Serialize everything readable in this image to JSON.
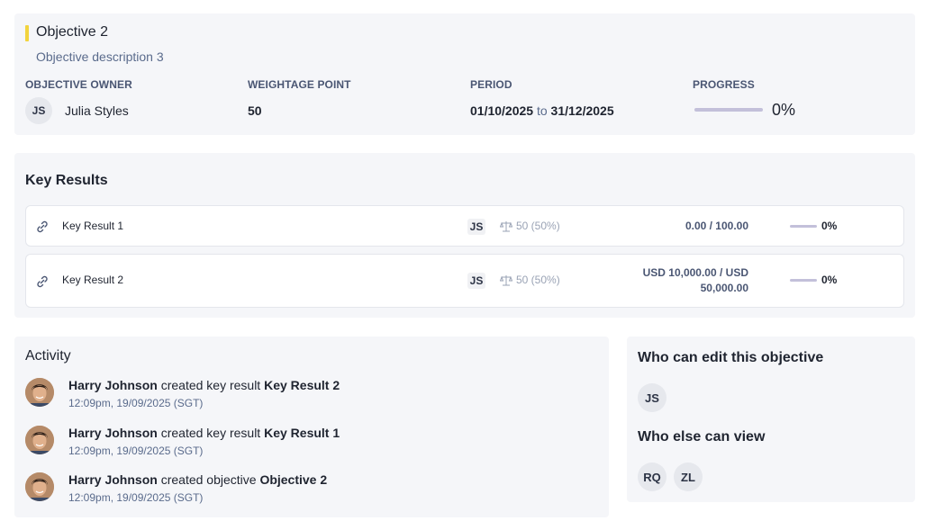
{
  "objective": {
    "title": "Objective 2",
    "description": "Objective description 3",
    "owner_label": "OBJECTIVE OWNER",
    "owner_initials": "JS",
    "owner_name": "Julia Styles",
    "weightage_label": "WEIGHTAGE POINT",
    "weightage_value": "50",
    "period_label": "PERIOD",
    "period_start": "01/10/2025",
    "period_to": "to",
    "period_end": "31/12/2025",
    "progress_label": "PROGRESS",
    "progress_value": "0%",
    "progress_fraction": 0,
    "accent_color": "#f2d43d"
  },
  "key_results": {
    "heading": "Key Results",
    "items": [
      {
        "icon": "link-icon",
        "name": "Key Result 1",
        "owner": "JS",
        "weight": "50 (50%)",
        "value": "0.00 / 100.00",
        "progress": "0%"
      },
      {
        "icon": "link-icon",
        "name": "Key Result 2",
        "owner": "JS",
        "weight": "50 (50%)",
        "value": "USD 10,000.00 / USD 50,000.00",
        "progress": "0%"
      }
    ]
  },
  "activity": {
    "heading": "Activity",
    "items": [
      {
        "user": "Harry Johnson",
        "action": "created key result",
        "target": "Key Result 2",
        "time": "12:09pm, 19/09/2025 (SGT)"
      },
      {
        "user": "Harry Johnson",
        "action": "created key result",
        "target": "Key Result 1",
        "time": "12:09pm, 19/09/2025 (SGT)"
      },
      {
        "user": "Harry Johnson",
        "action": "created objective",
        "target": "Objective 2",
        "time": "12:09pm, 19/09/2025 (SGT)"
      }
    ]
  },
  "permissions": {
    "edit_heading": "Who can edit this objective",
    "editors": [
      "JS"
    ],
    "view_heading": "Who else can view",
    "viewers": [
      "RQ",
      "ZL"
    ]
  }
}
